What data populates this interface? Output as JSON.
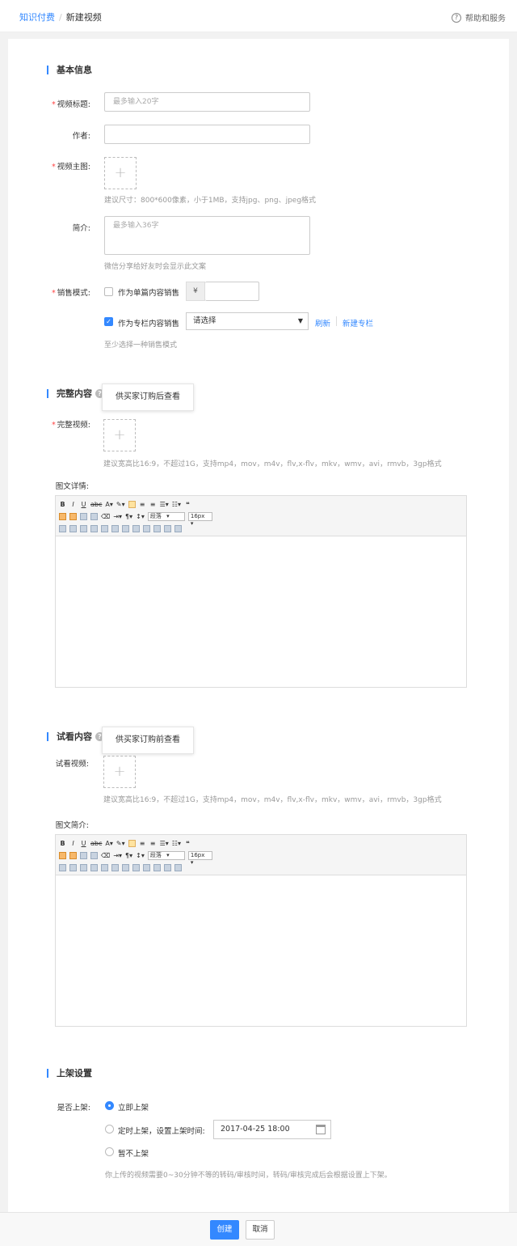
{
  "breadcrumb": {
    "parent": "知识付费",
    "separator": "/",
    "current": "新建视频"
  },
  "help": {
    "icon": "question-circle-icon",
    "label": "帮助和服务"
  },
  "basic": {
    "title": "基本信息",
    "video_title": {
      "label": "视频标题:",
      "placeholder": "最多输入20字"
    },
    "author": {
      "label": "作者:",
      "value": ""
    },
    "cover": {
      "label": "视频主图:",
      "plus": "+",
      "hint": "建议尺寸：800*600像素，小于1MB，支持jpg、png、jpeg格式"
    },
    "summary": {
      "label": "简介:",
      "placeholder": "最多输入36字",
      "hint": "微信分享给好友时会显示此文案"
    },
    "sale_mode": {
      "label": "销售模式:",
      "single": {
        "label": "作为单篇内容销售",
        "checked": false,
        "currency": "¥",
        "price": ""
      },
      "column": {
        "label": "作为专栏内容销售",
        "checked": true,
        "select_value": "请选择",
        "refresh": "刷新",
        "new_column": "新建专栏"
      },
      "hint": "至少选择一种销售模式"
    }
  },
  "full": {
    "title": "完整内容",
    "tooltip": "供买家订购后查看",
    "video": {
      "label": "完整视频:",
      "plus": "+",
      "hint": "建议宽高比16:9，不超过1G，支持mp4，mov，m4v，flv,x-flv，mkv，wmv，avi，rmvb，3gp格式"
    },
    "detail_label": "图文详情:",
    "editor": {
      "paragraph": "段落",
      "font_size": "16px"
    }
  },
  "trial": {
    "title": "试看内容",
    "tooltip": "供买家订购前查看",
    "video": {
      "label": "试看视频:",
      "plus": "+",
      "hint": "建议宽高比16:9，不超过1G，支持mp4，mov，m4v，flv,x-flv，mkv，wmv，avi，rmvb，3gp格式"
    },
    "detail_label": "图文简介:",
    "editor": {
      "paragraph": "段落",
      "font_size": "16px"
    }
  },
  "shelf": {
    "title": "上架设置",
    "label": "是否上架:",
    "options": [
      "立即上架",
      "定时上架，设置上架时间:",
      "暂不上架"
    ],
    "selected": 0,
    "datetime": "2017-04-25 18:00",
    "hint": "你上传的视频需要0~30分钟不等的转码/审核时间，转码/审核完成后会根据设置上下架。"
  },
  "footer": {
    "create": "创建",
    "cancel": "取消"
  },
  "colors": {
    "accent": "#3388ff",
    "required": "#ff4444"
  }
}
